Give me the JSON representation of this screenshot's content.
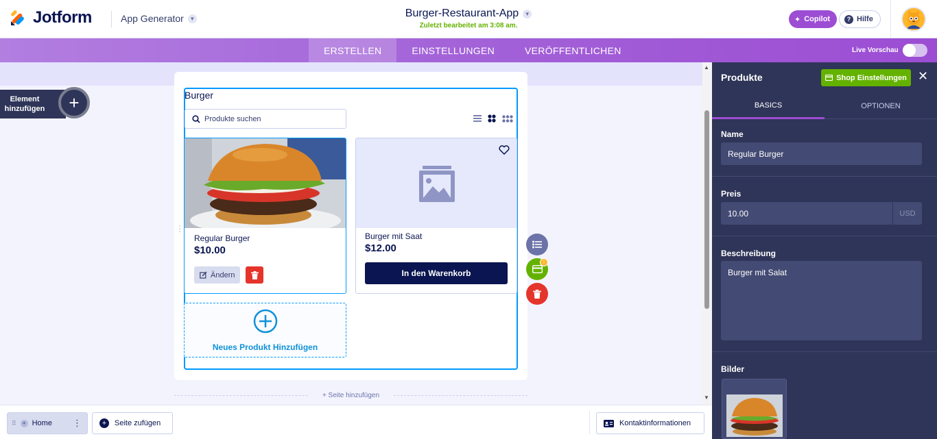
{
  "header": {
    "brand": "Jotform",
    "app_generator": "App Generator",
    "app_title": "Burger-Restaurant-App",
    "last_edited": "Zuletzt bearbeitet am 3:08 am.",
    "copilot": "Copilot",
    "help": "Hilfe"
  },
  "nav": {
    "tabs": [
      {
        "label": "ERSTELLEN",
        "active": true
      },
      {
        "label": "EINSTELLUNGEN",
        "active": false
      },
      {
        "label": "VERÖFFENTLICHEN",
        "active": false
      }
    ],
    "live_preview": "Live Vorschau"
  },
  "canvas": {
    "add_element": "Element hinzufügen",
    "widget_title": "Burger",
    "search_placeholder": "Produkte suchen",
    "products": [
      {
        "name": "Regular Burger",
        "price": "$10.00",
        "edit": "Ändern"
      },
      {
        "name": "Burger mit Saat",
        "price": "$12.00",
        "cart": "In den Warenkorb"
      }
    ],
    "new_product": "Neues Produkt Hinzufügen",
    "add_page_line": "+ Seite hinzufügen",
    "badge": "!"
  },
  "bottombar": {
    "page_home": "Home",
    "add_page": "Seite zufügen",
    "contact": "Kontaktinformationen"
  },
  "panel": {
    "title": "Produkte",
    "shop_settings": "Shop Einstellungen",
    "tabs": [
      {
        "label": "BASICS",
        "active": true
      },
      {
        "label": "OPTIONEN",
        "active": false
      }
    ],
    "name_label": "Name",
    "name_value": "Regular Burger",
    "price_label": "Preis",
    "price_value": "10.00",
    "currency": "USD",
    "description_label": "Beschreibung",
    "description_value": "Burger mit Salat",
    "images_label": "Bilder"
  },
  "colors": {
    "brand_purple": "#9c4dd3",
    "navy": "#0a1551",
    "green": "#64b200",
    "red": "#e5342b",
    "blue": "#0099ff",
    "panel_bg": "#2f3558"
  }
}
